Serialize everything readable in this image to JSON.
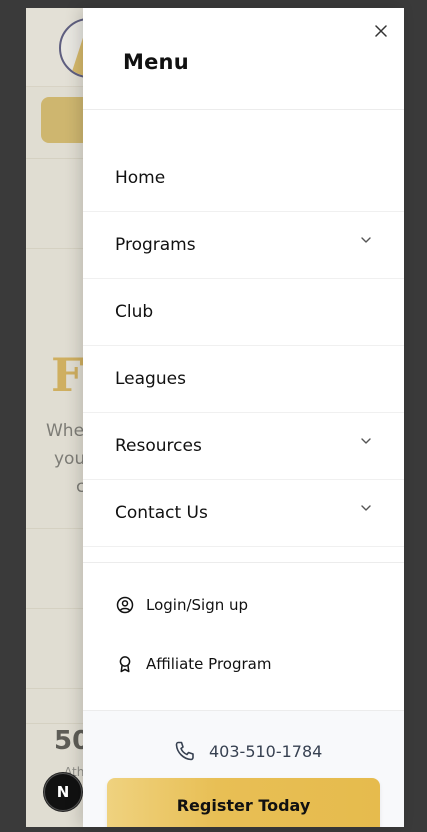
{
  "drawer": {
    "title": "Menu",
    "close_icon": "close-icon",
    "nav_items": [
      {
        "label": "Home",
        "has_submenu": false
      },
      {
        "label": "Programs",
        "has_submenu": true
      },
      {
        "label": "Club",
        "has_submenu": false
      },
      {
        "label": "Leagues",
        "has_submenu": false
      },
      {
        "label": "Resources",
        "has_submenu": true
      },
      {
        "label": "Contact Us",
        "has_submenu": true
      }
    ],
    "secondary_items": [
      {
        "label": "Login/Sign up",
        "icon": "user-circle-icon"
      },
      {
        "label": "Affiliate Program",
        "icon": "award-icon"
      }
    ],
    "phone": "403-510-1784",
    "register_label": "Register Today"
  },
  "background_page": {
    "hero_partial": "Fl",
    "text_lines": [
      "Whe",
      "you",
      "c"
    ],
    "stat_partial": "50",
    "stat_sub_partial": "Ath"
  },
  "badge": {
    "label": "N"
  },
  "colors": {
    "accent": "#e6bb4d",
    "drawer_bg": "#ffffff",
    "footer_bg": "#f8f9fb",
    "text": "#111111"
  }
}
